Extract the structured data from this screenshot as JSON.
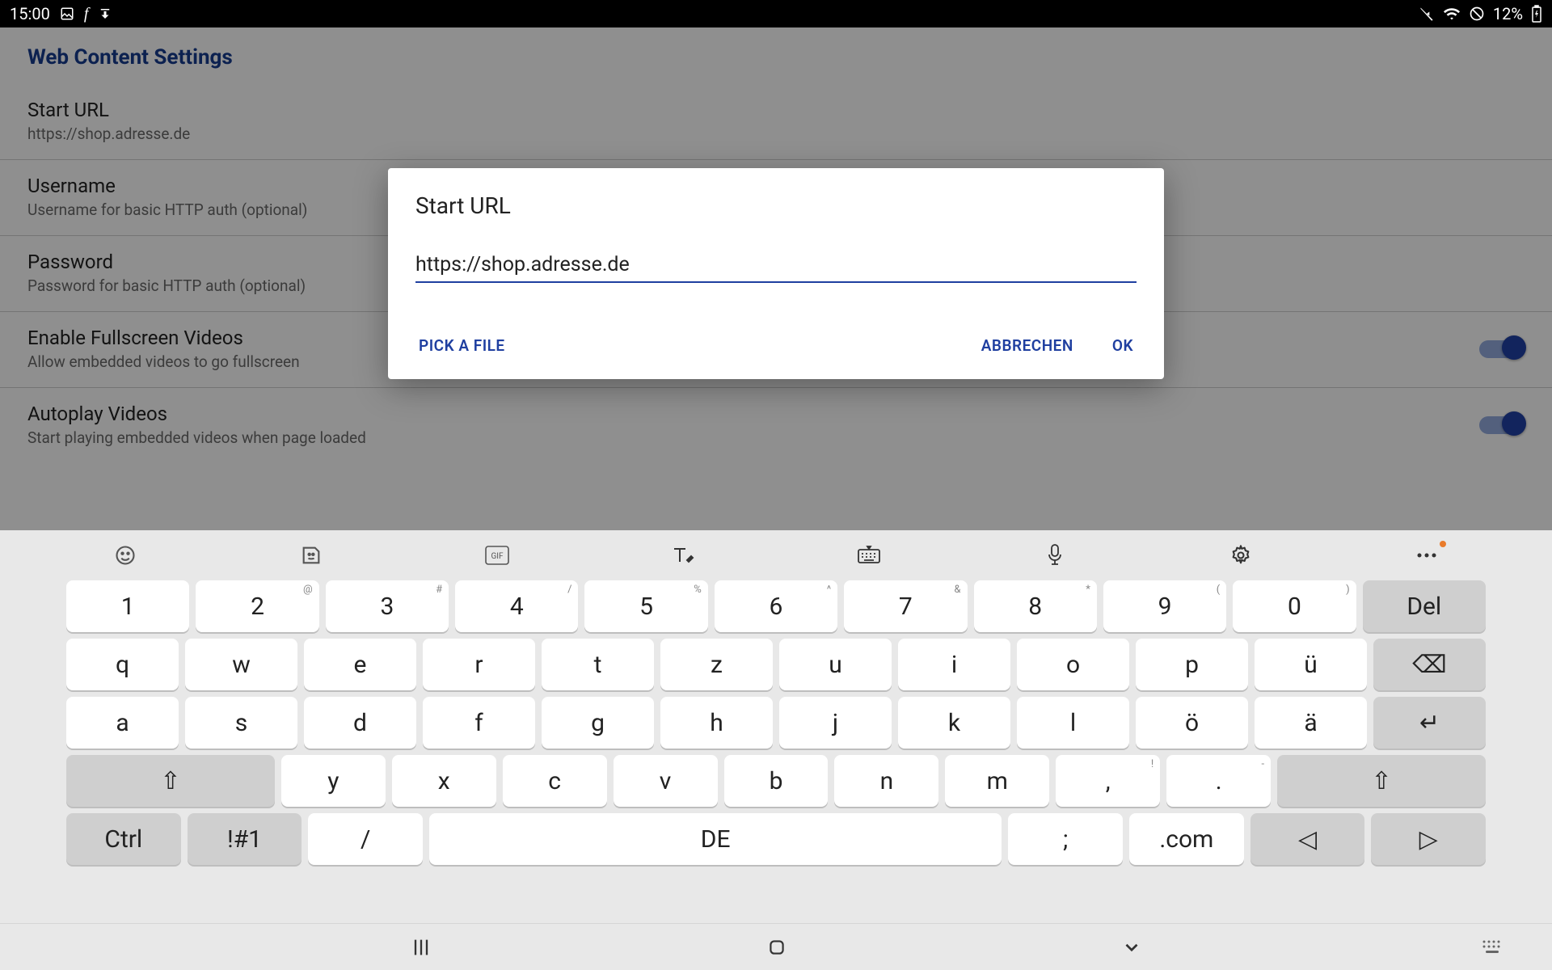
{
  "status": {
    "time": "15:00",
    "battery": "12%"
  },
  "settings": {
    "section_title": "Web Content Settings",
    "rows": [
      {
        "title": "Start URL",
        "sub": "https://shop.adresse.de",
        "toggle": false
      },
      {
        "title": "Username",
        "sub": "Username for basic HTTP auth (optional)",
        "toggle": false
      },
      {
        "title": "Password",
        "sub": "Password for basic HTTP auth (optional)",
        "toggle": false
      },
      {
        "title": "Enable Fullscreen Videos",
        "sub": "Allow embedded videos to go fullscreen",
        "toggle": true
      },
      {
        "title": "Autoplay Videos",
        "sub": "Start playing embedded videos when page loaded",
        "toggle": true
      }
    ]
  },
  "dialog": {
    "title": "Start URL",
    "value": "https://shop.adresse.de",
    "pick_file": "PICK A FILE",
    "cancel": "ABBRECHEN",
    "ok": "OK"
  },
  "keyboard": {
    "rows": [
      [
        {
          "main": "1",
          "corner": ""
        },
        {
          "main": "2",
          "corner": "@"
        },
        {
          "main": "3",
          "corner": "#"
        },
        {
          "main": "4",
          "corner": "/"
        },
        {
          "main": "5",
          "corner": "%"
        },
        {
          "main": "6",
          "corner": "^"
        },
        {
          "main": "7",
          "corner": "&"
        },
        {
          "main": "8",
          "corner": "*"
        },
        {
          "main": "9",
          "corner": "("
        },
        {
          "main": "0",
          "corner": ")"
        },
        {
          "main": "Del",
          "gray": true
        }
      ],
      [
        {
          "main": "q"
        },
        {
          "main": "w"
        },
        {
          "main": "e"
        },
        {
          "main": "r"
        },
        {
          "main": "t"
        },
        {
          "main": "z"
        },
        {
          "main": "u"
        },
        {
          "main": "i"
        },
        {
          "main": "o"
        },
        {
          "main": "p"
        },
        {
          "main": "ü"
        },
        {
          "main": "⌫",
          "gray": true
        }
      ],
      [
        {
          "main": "a"
        },
        {
          "main": "s"
        },
        {
          "main": "d"
        },
        {
          "main": "f"
        },
        {
          "main": "g"
        },
        {
          "main": "h"
        },
        {
          "main": "j"
        },
        {
          "main": "k"
        },
        {
          "main": "l"
        },
        {
          "main": "ö"
        },
        {
          "main": "ä"
        },
        {
          "main": "↵",
          "gray": true
        }
      ],
      [
        {
          "main": "⇧",
          "gray": true,
          "w": 2
        },
        {
          "main": "y"
        },
        {
          "main": "x"
        },
        {
          "main": "c"
        },
        {
          "main": "v"
        },
        {
          "main": "b"
        },
        {
          "main": "n"
        },
        {
          "main": "m"
        },
        {
          "main": ",",
          "corner": "!"
        },
        {
          "main": ".",
          "corner": "-"
        },
        {
          "main": "⇧",
          "gray": true,
          "w": 2
        }
      ],
      [
        {
          "main": "Ctrl",
          "gray": true,
          "w": 1
        },
        {
          "main": "!#1",
          "gray": true,
          "w": 1
        },
        {
          "main": "/",
          "w": 1
        },
        {
          "main": "DE",
          "w": 4
        },
        {
          "main": ";",
          "w": 1
        },
        {
          "main": ".com",
          "w": 1
        },
        {
          "main": "◁",
          "gray": true,
          "w": 1
        },
        {
          "main": "▷",
          "gray": true,
          "w": 1
        }
      ]
    ]
  }
}
